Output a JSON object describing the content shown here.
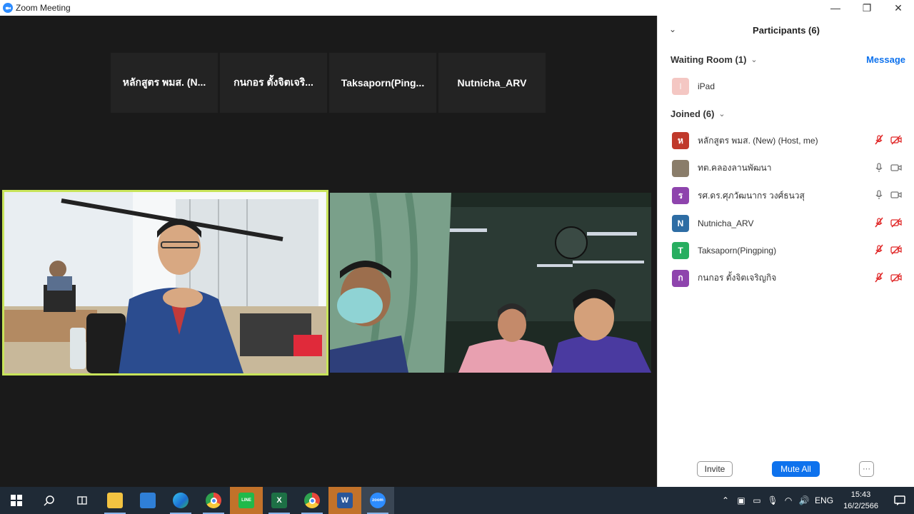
{
  "window": {
    "title": "Zoom Meeting",
    "minimize_glyph": "—",
    "restore_glyph": "❐",
    "close_glyph": "✕"
  },
  "name_tiles": [
    {
      "label": "หลักสูตร พมส. (N..."
    },
    {
      "label": "กนกอร ตั้งจิตเจริ..."
    },
    {
      "label": "Taksaporn(Ping..."
    },
    {
      "label": "Nutnicha_ARV"
    }
  ],
  "panel": {
    "title": "Participants (6)",
    "collapse_glyph": "⌄",
    "waiting_room": {
      "label": "Waiting Room (1)",
      "message_label": "Message"
    },
    "waiting": [
      {
        "name": "iPad",
        "initial": "I",
        "color": "#f4c7c3"
      }
    ],
    "joined_label": "Joined (6)",
    "joined": [
      {
        "name": "หลักสูตร พมส. (New) (Host, me)",
        "initial": "ห",
        "color": "#c0392b",
        "muted": true,
        "video_off": true
      },
      {
        "name": "ทต.คลองลานพัฒนา",
        "initial": "",
        "color": "#8a7d6a",
        "muted": false,
        "video_off": false
      },
      {
        "name": "รศ.ดร.ศุภวัฒนากร วงศ์ธนวสุ",
        "initial": "ร",
        "color": "#8e44ad",
        "muted": false,
        "video_off": false
      },
      {
        "name": "Nutnicha_ARV",
        "initial": "N",
        "color": "#2e6da4",
        "muted": true,
        "video_off": true
      },
      {
        "name": "Taksaporn(Pingping)",
        "initial": "T",
        "color": "#27ae60",
        "muted": true,
        "video_off": true
      },
      {
        "name": "กนกอร ตั้งจิตเจริญกิจ",
        "initial": "ก",
        "color": "#8e44ad",
        "muted": true,
        "video_off": true
      }
    ],
    "invite_label": "Invite",
    "mute_all_label": "Mute All",
    "more_label": "···"
  },
  "taskbar": {
    "apps": [
      {
        "name": "start-button",
        "icon": "windows-icon",
        "label": ""
      },
      {
        "name": "search-button",
        "icon": "search-icon",
        "label": ""
      },
      {
        "name": "task-view-button",
        "icon": "task-view-icon",
        "label": ""
      },
      {
        "name": "file-explorer-app",
        "icon": "folder-icon",
        "label": ""
      },
      {
        "name": "mail-app",
        "icon": "mail-icon",
        "label": ""
      },
      {
        "name": "edge-app",
        "icon": "edge-icon",
        "label": ""
      },
      {
        "name": "chrome-app",
        "icon": "chrome-icon",
        "label": ""
      },
      {
        "name": "line-app",
        "icon": "line-icon",
        "label": "LINE"
      },
      {
        "name": "excel-app",
        "icon": "excel-icon",
        "label": "X"
      },
      {
        "name": "chrome-app-2",
        "icon": "chrome-icon",
        "label": ""
      },
      {
        "name": "word-app",
        "icon": "word-icon",
        "label": "W"
      },
      {
        "name": "zoom-app",
        "icon": "zoom-icon",
        "label": "zoom"
      }
    ],
    "language": "ENG",
    "time": "15:43",
    "date": "16/2/2566"
  },
  "colors": {
    "accent": "#0e72ed",
    "active_speaker_border": "#c8e45a",
    "muted_red": "#e02828"
  }
}
